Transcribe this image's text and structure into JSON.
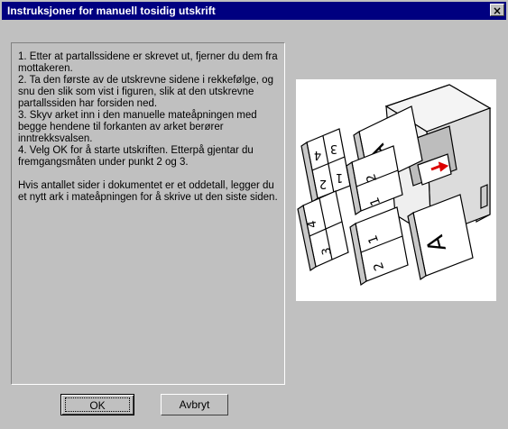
{
  "window": {
    "title": "Instruksjoner for manuell tosidig utskrift",
    "close_glyph": "×"
  },
  "instructions": {
    "step1": "1. Etter at partallssidene er skrevet ut, fjerner du dem fra mottakeren.",
    "step2": "2. Ta den første av de utskrevne sidene i rekkefølge, og snu den slik som vist i figuren, slik at den utskrevne partallssiden har forsiden ned.",
    "step3": "3. Skyv arket inn i den manuelle mateåpningen med begge hendene til forkanten av arket berører inntrekksvalsen.",
    "step4": "4. Velg OK for å starte utskriften. Etterpå gjentar du fremgangsmåten under punkt 2 og 3.",
    "note": " Hvis antallet sider i dokumentet er et oddetall, legger du et nytt ark i mateåpningen for å skrive ut den siste siden."
  },
  "figure": {
    "page_letters": [
      "A",
      "A"
    ],
    "page_numbers": [
      "4",
      "3",
      "2",
      "1",
      "2",
      "1",
      "4",
      "3",
      "1",
      "2"
    ]
  },
  "buttons": {
    "ok_label": "OK",
    "cancel_label": "Avbryt"
  }
}
